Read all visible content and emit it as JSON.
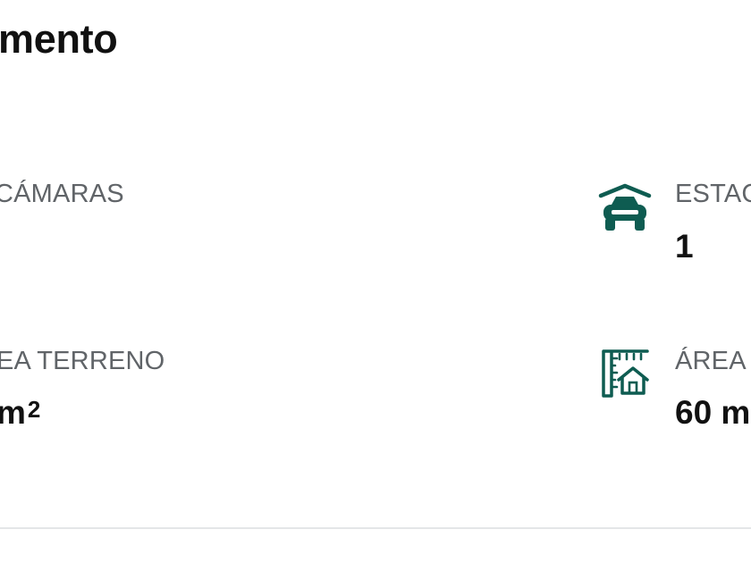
{
  "header": {
    "title": "mento"
  },
  "features": [
    {
      "label": "CÁMARAS",
      "value": "",
      "unit": "",
      "icon": ""
    },
    {
      "label": "ESTAC",
      "value": "1",
      "unit": "",
      "icon": "parking-garage-car-icon"
    },
    {
      "label": "EA TERRENO",
      "value": "m",
      "unit": "2",
      "icon": ""
    },
    {
      "label": "ÁREA",
      "value": "60 m",
      "unit": "",
      "icon": "built-area-house-icon"
    }
  ],
  "colors": {
    "icon": "#0e5c51",
    "text": "#111111",
    "label": "#606468",
    "divider": "#e4e6e8"
  }
}
